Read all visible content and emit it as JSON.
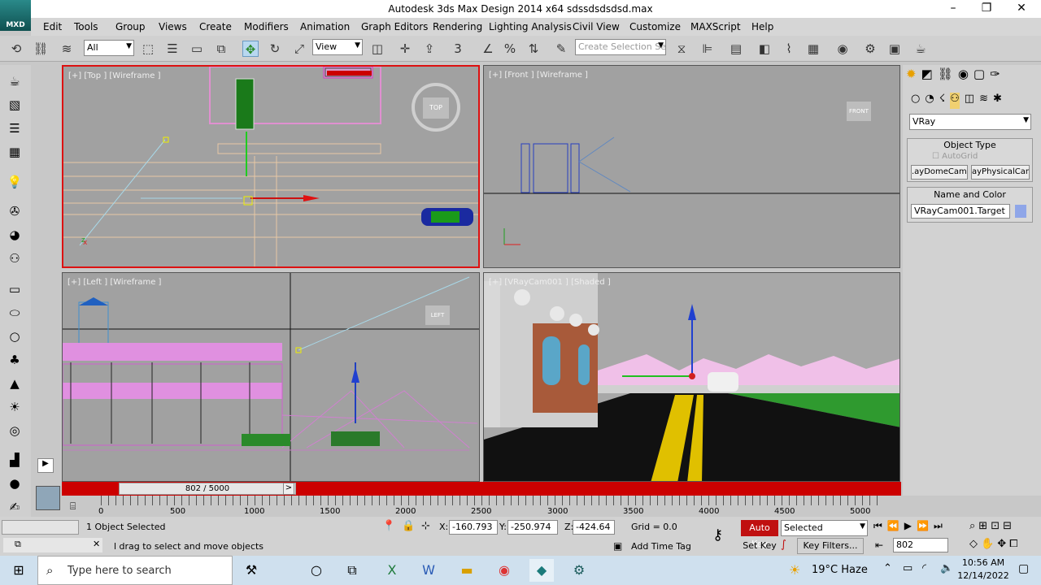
{
  "window": {
    "title": "Autodesk 3ds Max Design 2014 x64     sdssdsdsdsd.max",
    "logo": "MXD"
  },
  "menu": [
    "Edit",
    "Tools",
    "Group",
    "Views",
    "Create",
    "Modifiers",
    "Animation",
    "Graph Editors",
    "Rendering",
    "Lighting Analysis",
    "Civil View",
    "Customize",
    "MAXScript",
    "Help"
  ],
  "toolbar": {
    "filter": "All",
    "refcoord": "View",
    "selection_set_placeholder": "Create Selection Se",
    "snap_label": "3"
  },
  "viewports": {
    "top": "[+] [Top ] [Wireframe ]",
    "front": "[+] [Front ] [Wireframe ]",
    "left": "[+] [Left ] [Wireframe ]",
    "camera": "[+] [VRayCam001 ] [Shaded ]",
    "cube_top": "TOP",
    "cube_front": "FRONT",
    "cube_left": "LEFT"
  },
  "command_panel": {
    "renderer": "VRay",
    "object_type": "Object Type",
    "autogrid": "AutoGrid",
    "btn1": ".ayDomeCame",
    "btn2": "ayPhysicalCam",
    "name_and_color": "Name and Color",
    "name_value": "VRayCam001.Target",
    "color": "#8fa6e8"
  },
  "timeline": {
    "slider": "802 / 5000",
    "ticks": [
      "0",
      "500",
      "1000",
      "1500",
      "2000",
      "2500",
      "3000",
      "3500",
      "4000",
      "4500",
      "5000"
    ]
  },
  "status": {
    "selected": "1 Object Selected",
    "prompt": "l drag to select and move objects",
    "x": "-160.793",
    "y": "-250.974",
    "z": "-424.64",
    "grid": "Grid = 0.0",
    "add_time_tag": "Add Time Tag",
    "auto_key": "Auto Key",
    "selected_combo": "Selected",
    "set_key": "Set Key",
    "key_filters": "Key Filters...",
    "frame": "802"
  },
  "taskbar": {
    "search_placeholder": "Type here to search",
    "weather": "19°C  Haze",
    "time": "10:56 AM",
    "date": "12/14/2022"
  }
}
